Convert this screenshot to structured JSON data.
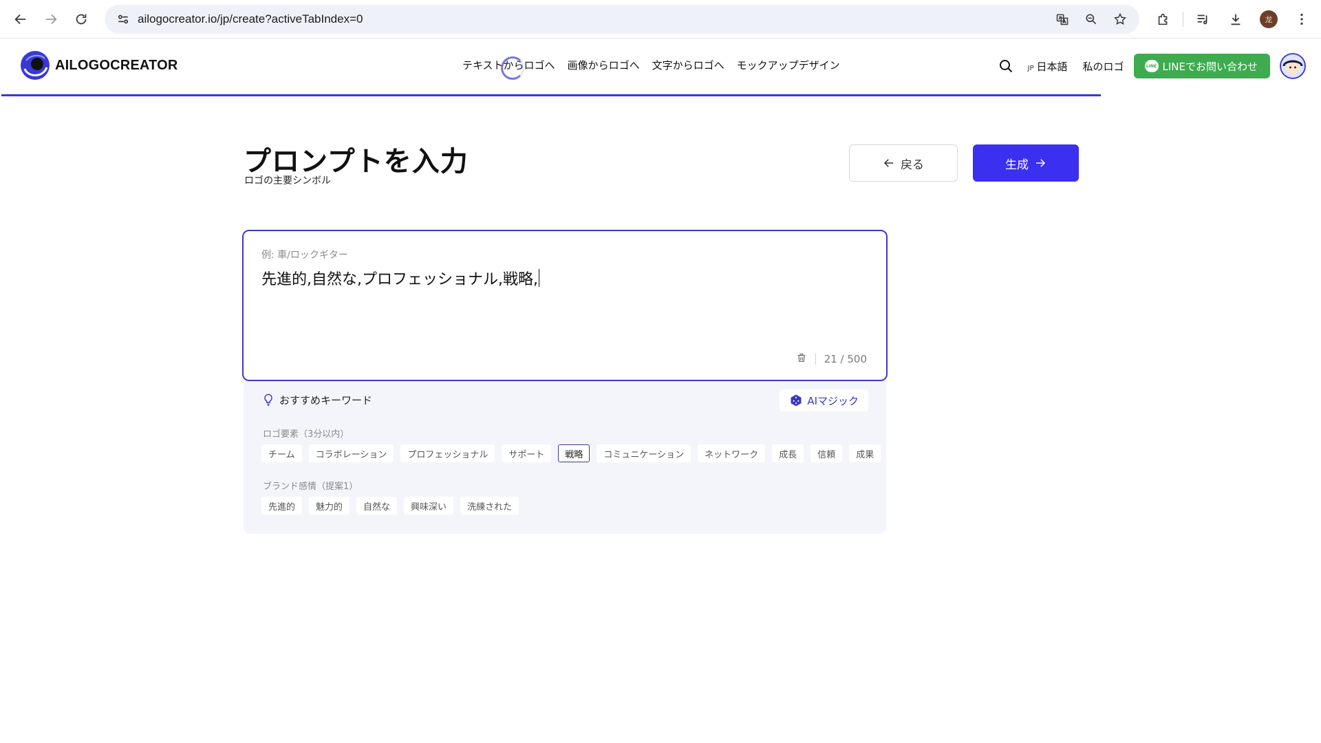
{
  "browser": {
    "url": "ailogocreator.io/jp/create?activeTabIndex=0",
    "profile_initial": "龙"
  },
  "site": {
    "logo_text": "AILOGOCREATOR",
    "nav": [
      {
        "label": "テキストからロゴへ"
      },
      {
        "label": "画像からロゴへ"
      },
      {
        "label": "文字からロゴへ"
      },
      {
        "label": "モックアップデザイン"
      }
    ],
    "lang_code": "JP",
    "lang_label": "日本語",
    "my_logo": "私のロゴ",
    "line_button": "LINEでお問い合わせ",
    "line_icon_text": "LINE"
  },
  "main": {
    "title": "プロンプトを入力",
    "subtitle": "ロゴの主要シンボル",
    "back_label": "戻る",
    "generate_label": "生成",
    "prompt": {
      "placeholder_label": "例: 車/ロックギター",
      "value": "先進的,自然な,プロフェッショナル,戦略,",
      "count": "21 / 500"
    },
    "keywords": {
      "heading": "おすすめキーワード",
      "ai_magic": "AIマジック",
      "groups": [
        {
          "label": "ロゴ要素（3分以内）",
          "chips": [
            {
              "label": "チーム",
              "selected": false
            },
            {
              "label": "コラボレーション",
              "selected": false
            },
            {
              "label": "プロフェッショナル",
              "selected": false
            },
            {
              "label": "サポート",
              "selected": false
            },
            {
              "label": "戦略",
              "selected": true
            },
            {
              "label": "コミュニケーション",
              "selected": false
            },
            {
              "label": "ネットワーク",
              "selected": false
            },
            {
              "label": "成長",
              "selected": false
            },
            {
              "label": "信頼",
              "selected": false
            },
            {
              "label": "成果",
              "selected": false
            }
          ]
        },
        {
          "label": "ブランド感情（提案1）",
          "chips": [
            {
              "label": "先進的",
              "selected": false
            },
            {
              "label": "魅力的",
              "selected": false
            },
            {
              "label": "自然な",
              "selected": false
            },
            {
              "label": "興味深い",
              "selected": false
            },
            {
              "label": "洗練された",
              "selected": false
            }
          ]
        }
      ]
    }
  },
  "colors": {
    "accent": "#3b2ff0",
    "border_focus": "#3d38c8",
    "line_green": "#3eab4e",
    "panel_bg": "#f4f5fb"
  }
}
